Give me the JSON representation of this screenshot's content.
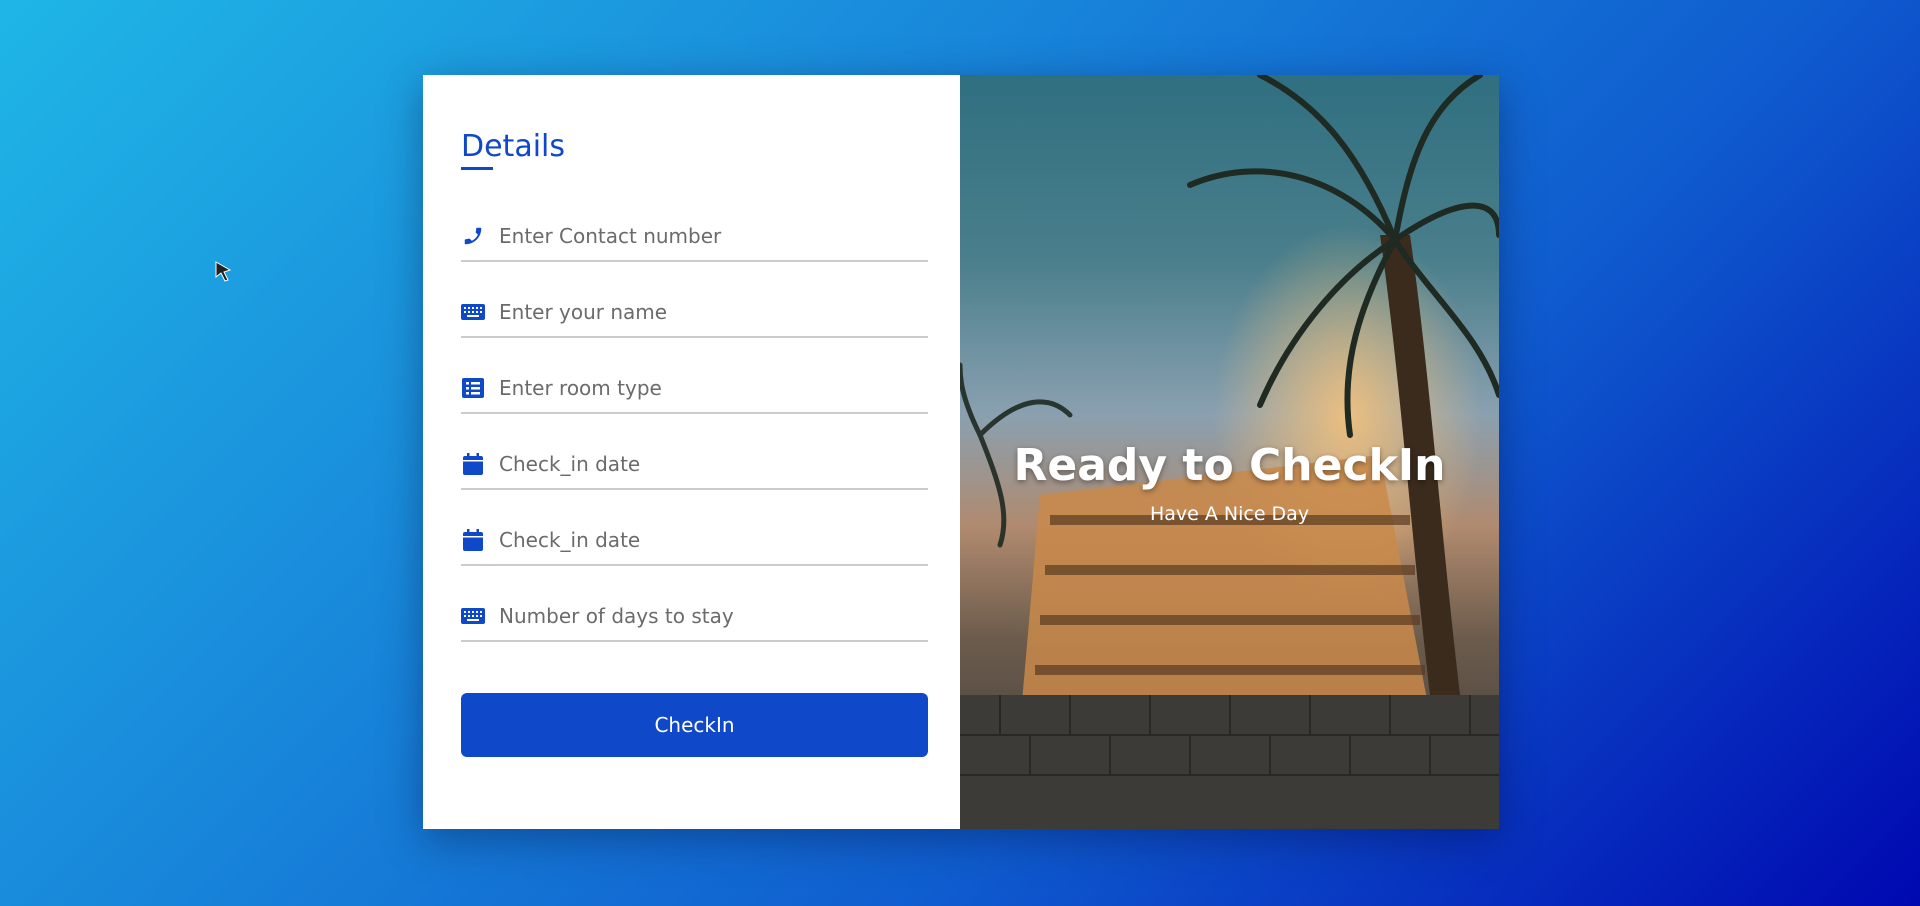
{
  "form": {
    "title": "Details",
    "fields": [
      {
        "icon": "phone-icon",
        "placeholder": "Enter Contact number"
      },
      {
        "icon": "keyboard-icon",
        "placeholder": "Enter your name"
      },
      {
        "icon": "list-icon",
        "placeholder": "Enter room type"
      },
      {
        "icon": "calendar-icon",
        "placeholder": "Check_in date"
      },
      {
        "icon": "calendar-icon",
        "placeholder": "Check_in date"
      },
      {
        "icon": "keyboard-icon",
        "placeholder": "Number of days to stay"
      }
    ],
    "submit_label": "CheckIn"
  },
  "hero": {
    "headline": "Ready to CheckIn",
    "subline": "Have A Nice Day"
  },
  "colors": {
    "accent": "#0f48c8",
    "field_border": "#cccccc"
  }
}
